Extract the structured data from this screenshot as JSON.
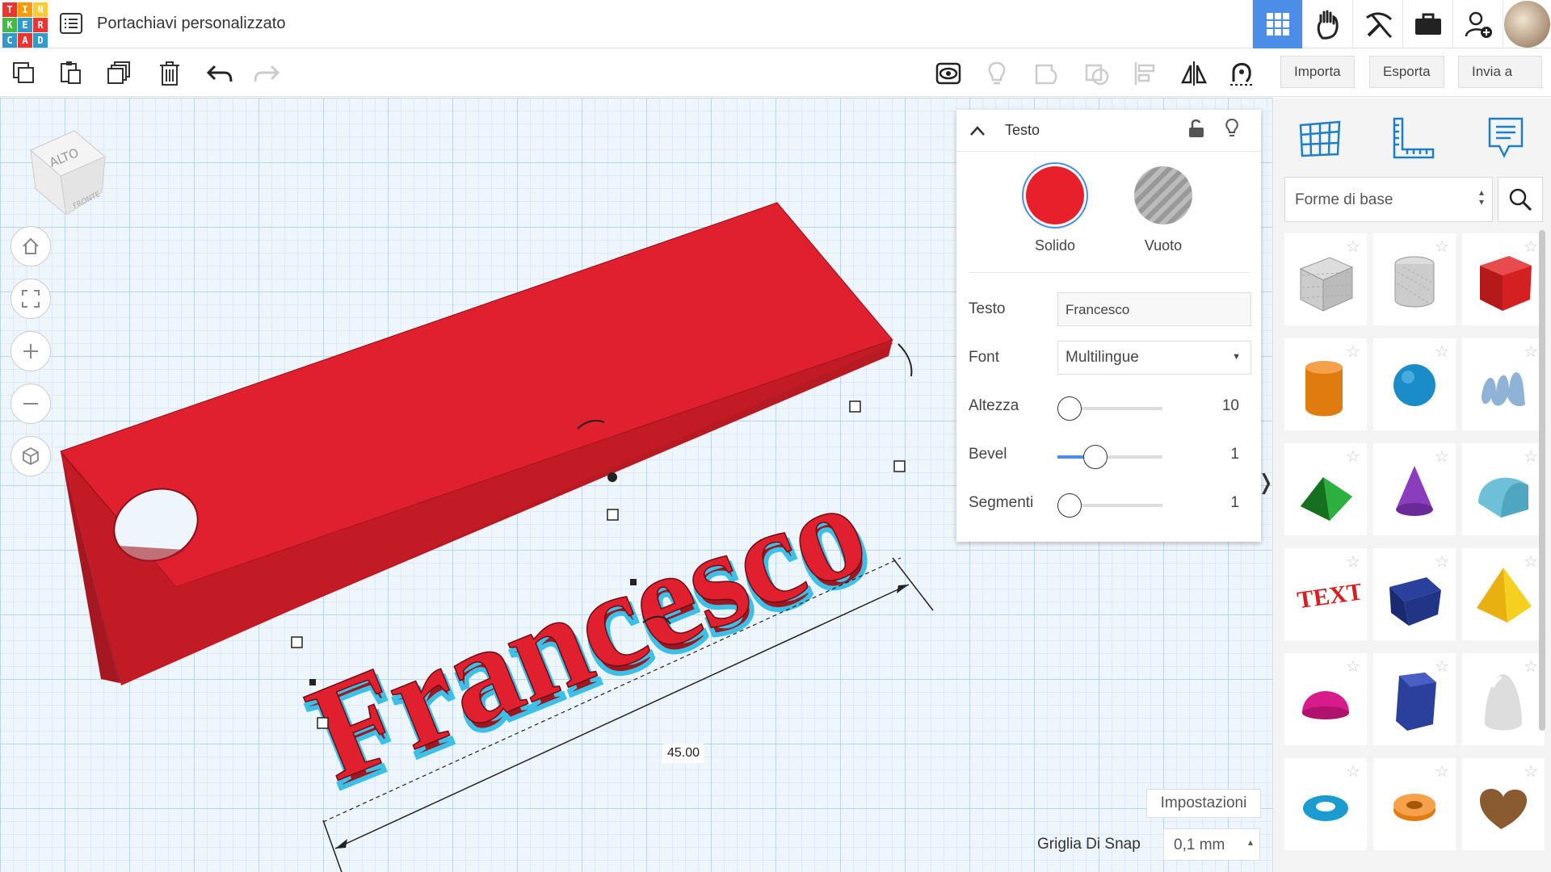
{
  "app": {
    "logo_letters": [
      "T",
      "I",
      "N",
      "K",
      "E",
      "R",
      "C",
      "A",
      "D"
    ],
    "logo_colors": [
      "#e33",
      "#f90",
      "#fc3",
      "#4b4",
      "#39c",
      "#e33",
      "#39c",
      "#e33",
      "#39c"
    ],
    "title": "Portachiavi personalizzato"
  },
  "toolbar": {
    "import_label": "Importa",
    "export_label": "Esporta",
    "send_label": "Invia a"
  },
  "viewcube": {
    "top_label": "ALTO",
    "front_label": "FRONTE"
  },
  "scene": {
    "text_object": "Francesco",
    "dimension_label": "45.00",
    "object_color": "#e0202e",
    "selection_color": "#3cc0e8"
  },
  "inspector": {
    "title": "Testo",
    "solid_label": "Solido",
    "hole_label": "Vuoto",
    "solid_color": "#e8202c",
    "props": [
      {
        "label": "Testo",
        "value": "Francesco"
      },
      {
        "label": "Font",
        "value": "Multilingue"
      },
      {
        "label": "Altezza",
        "value": "10",
        "level": 0.0
      },
      {
        "label": "Bevel",
        "value": "1",
        "level": 0.35
      },
      {
        "label": "Segmenti",
        "value": "1",
        "level": 0.1
      }
    ]
  },
  "bottom": {
    "settings_label": "Impostazioni",
    "snap_label": "Griglia Di Snap",
    "snap_value": "0,1 mm"
  },
  "rpanel": {
    "category": "Forme di base",
    "shapes": [
      "box-hole",
      "cylinder-hole",
      "box",
      "cylinder",
      "sphere",
      "scribble",
      "roof",
      "cone",
      "round-roof",
      "text",
      "wedge",
      "pyramid",
      "half-sphere",
      "polygon",
      "paraboloid",
      "torus",
      "tube",
      "heart"
    ]
  }
}
